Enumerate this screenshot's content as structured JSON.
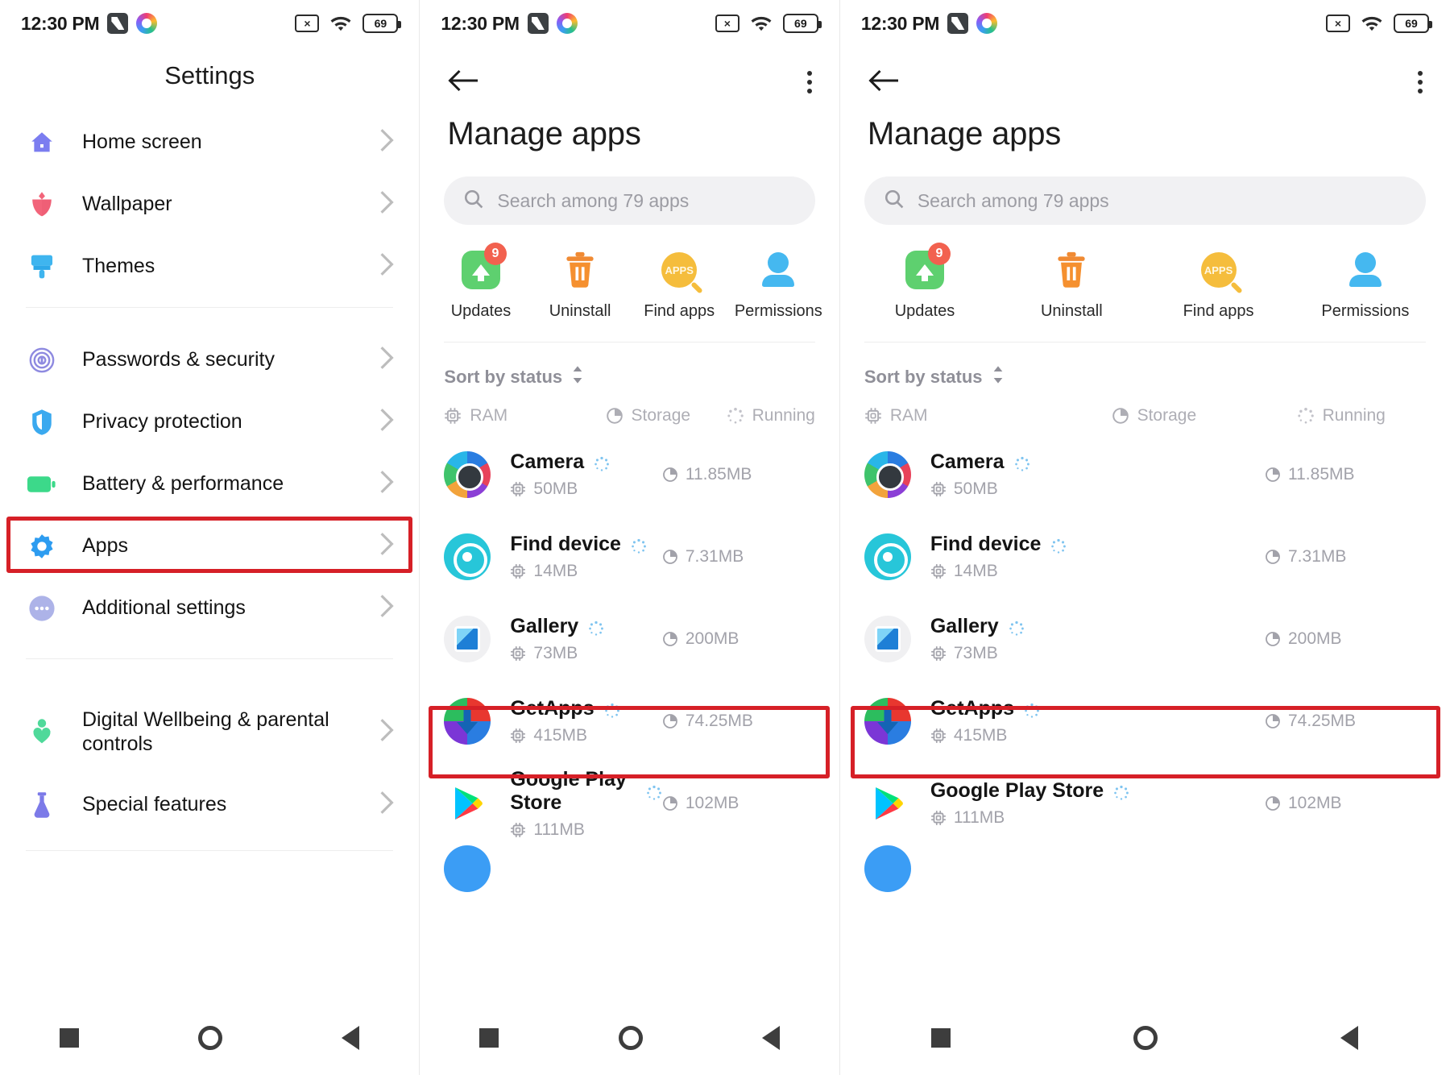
{
  "statusbar": {
    "time": "12:30 PM",
    "battery": "69",
    "icons": [
      "gpay-icon",
      "photos-icon",
      "no-sms-icon",
      "wifi-icon",
      "battery-icon"
    ]
  },
  "settings_screen": {
    "title": "Settings",
    "groups": [
      {
        "items": [
          {
            "label": "Home screen",
            "icon": "home-icon",
            "color": "#7b7df0"
          },
          {
            "label": "Wallpaper",
            "icon": "flower-icon",
            "color": "#f2647a"
          },
          {
            "label": "Themes",
            "icon": "paintbrush-icon",
            "color": "#3fb5ef"
          }
        ]
      },
      {
        "items": [
          {
            "label": "Passwords & security",
            "icon": "fingerprint-icon",
            "color": "#8e8ae0"
          },
          {
            "label": "Privacy protection",
            "icon": "shield-icon",
            "color": "#3aa9ef"
          },
          {
            "label": "Battery & performance",
            "icon": "battery-icon",
            "color": "#3cd98a"
          },
          {
            "label": "Apps",
            "icon": "gear-icon",
            "color": "#2d9cf0",
            "highlighted": true
          },
          {
            "label": "Additional settings",
            "icon": "ellipsis-icon",
            "color": "#adb3e8"
          }
        ]
      },
      {
        "items": [
          {
            "label": "Digital Wellbeing & parental controls",
            "icon": "person-heart-icon",
            "color": "#4fd99a"
          },
          {
            "label": "Special features",
            "icon": "flask-icon",
            "color": "#7c7ae8"
          }
        ]
      }
    ]
  },
  "manage_apps": {
    "title": "Manage apps",
    "back_label": "Back",
    "menu_label": "More options",
    "search": {
      "placeholder": "Search among 79 apps",
      "value": ""
    },
    "actions": [
      {
        "label": "Updates",
        "icon": "update-arrow-icon",
        "badge": "9"
      },
      {
        "label": "Uninstall",
        "icon": "trash-icon",
        "badge": ""
      },
      {
        "label": "Find apps",
        "icon": "apps-search-icon",
        "badge": ""
      },
      {
        "label": "Permissions",
        "icon": "person-icon",
        "badge": ""
      }
    ],
    "sort": {
      "label": "Sort by status",
      "icon": "sort-chevrons-icon"
    },
    "filters": [
      {
        "label": "RAM",
        "icon": "chip-icon"
      },
      {
        "label": "Storage",
        "icon": "pie-icon"
      },
      {
        "label": "Running",
        "icon": "spinner-icon"
      }
    ],
    "apps": [
      {
        "name": "Camera",
        "ram": "50MB",
        "storage": "11.85MB",
        "icon": "camera-icon",
        "highlighted": false
      },
      {
        "name": "Find device",
        "ram": "14MB",
        "storage": "7.31MB",
        "icon": "find-device-icon",
        "highlighted": false
      },
      {
        "name": "Gallery",
        "ram": "73MB",
        "storage": "200MB",
        "icon": "gallery-icon",
        "highlighted": false
      },
      {
        "name": "GetApps",
        "ram": "415MB",
        "storage": "74.25MB",
        "icon": "getapps-icon",
        "highlighted": true
      },
      {
        "name": "Google Play Store",
        "ram": "111MB",
        "storage": "102MB",
        "icon": "play-store-icon",
        "highlighted": false
      }
    ]
  },
  "navbar": {
    "recents_label": "Recents",
    "home_label": "Home",
    "back_label": "Back"
  },
  "colors": {
    "highlight": "#d62027",
    "accent": "#3b9df5",
    "muted_text": "#a2a2aa"
  }
}
